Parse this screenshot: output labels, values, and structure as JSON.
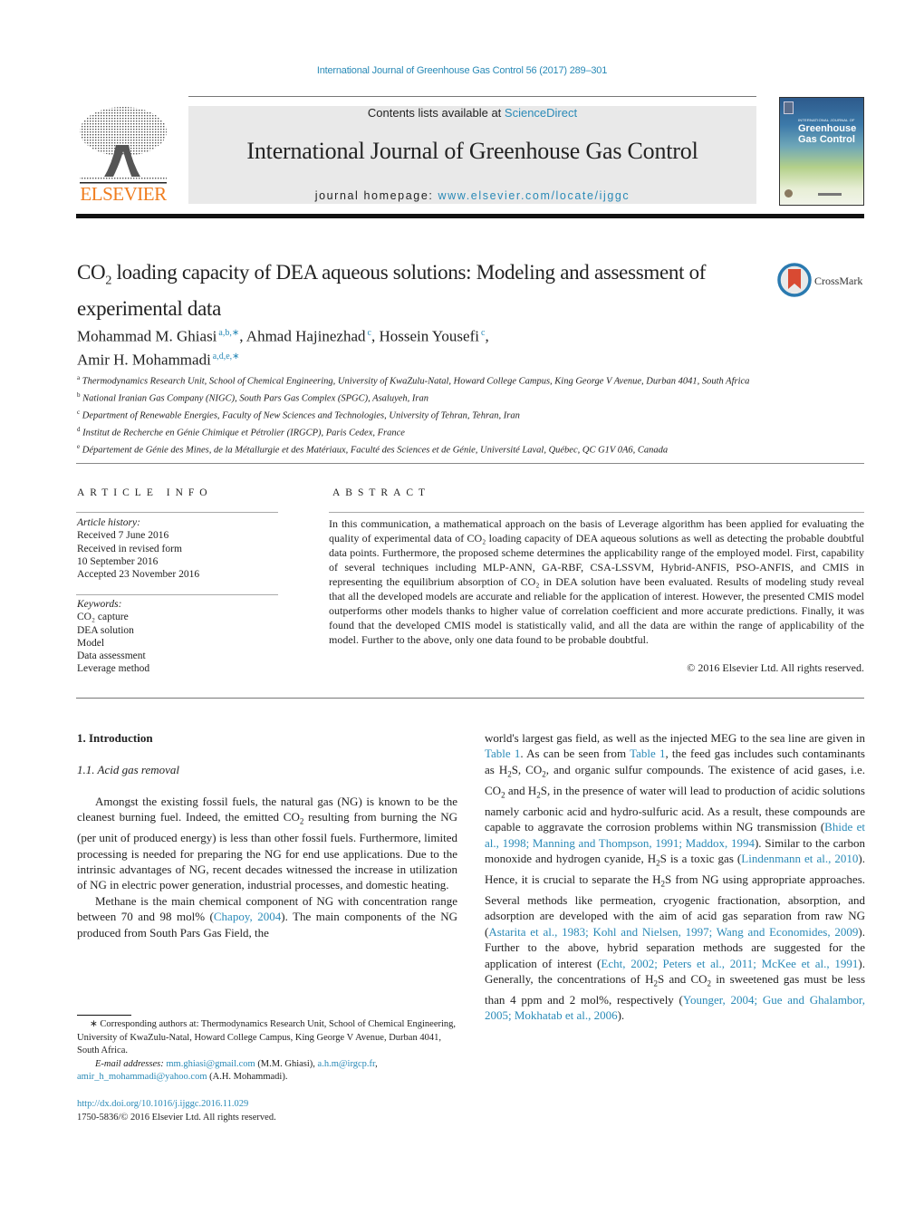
{
  "header": {
    "citation": "International Journal of Greenhouse Gas Control 56 (2017) 289–301",
    "publisher_logo_text": "ELSEVIER",
    "contents_prefix": "Contents lists available at ",
    "contents_link": "ScienceDirect",
    "journal_title": "International Journal of Greenhouse Gas Control",
    "homepage_prefix": "journal homepage: ",
    "homepage_link": "www.elsevier.com/locate/ijggc",
    "cover": {
      "small_text": "INTERNATIONAL JOURNAL OF",
      "title_line1": "Greenhouse",
      "title_line2": "Gas Control"
    }
  },
  "article": {
    "title_pre": "CO",
    "title_sub": "2",
    "title_post": " loading capacity of DEA aqueous solutions: Modeling and assessment of experimental data",
    "crossmark_label": "CrossMark",
    "authors": [
      {
        "name": "Mohammad M. Ghiasi",
        "sup": "a,b,∗",
        "sep": ", "
      },
      {
        "name": "Ahmad Hajinezhad",
        "sup": "c",
        "sep": ", "
      },
      {
        "name": "Hossein Yousefi",
        "sup": "c",
        "sep": ","
      },
      {
        "name": "Amir H. Mohammadi",
        "sup": "a,d,e,∗",
        "sep": ""
      }
    ],
    "affiliations": [
      {
        "key": "a",
        "text": "Thermodynamics Research Unit, School of Chemical Engineering, University of KwaZulu-Natal, Howard College Campus, King George V Avenue, Durban 4041, South Africa"
      },
      {
        "key": "b",
        "text": "National Iranian Gas Company (NIGC), South Pars Gas Complex (SPGC), Asaluyeh, Iran"
      },
      {
        "key": "c",
        "text": "Department of Renewable Energies, Faculty of New Sciences and Technologies, University of Tehran, Tehran, Iran"
      },
      {
        "key": "d",
        "text": "Institut de Recherche en Génie Chimique et Pétrolier (IRGCP), Paris Cedex, France"
      },
      {
        "key": "e",
        "text": "Département de Génie des Mines, de la Métallurgie et des Matériaux, Faculté des Sciences et de Génie, Université Laval, Québec, QC G1V 0A6, Canada"
      }
    ]
  },
  "article_info": {
    "heading": "ARTICLE INFO",
    "history_label": "Article history:",
    "history": [
      "Received 7 June 2016",
      "Received in revised form",
      "10 September 2016",
      "Accepted 23 November 2016"
    ],
    "keywords_label": "Keywords:",
    "keywords": [
      "CO₂ capture",
      "DEA solution",
      "Model",
      "Data assessment",
      "Leverage method"
    ]
  },
  "abstract": {
    "heading": "ABSTRACT",
    "text": "In this communication, a mathematical approach on the basis of Leverage algorithm has been applied for evaluating the quality of experimental data of CO₂ loading capacity of DEA aqueous solutions as well as detecting the probable doubtful data points. Furthermore, the proposed scheme determines the applicability range of the employed model. First, capability of several techniques including MLP-ANN, GA-RBF, CSA-LSSVM, Hybrid-ANFIS, PSO-ANFIS, and CMIS in representing the equilibrium absorption of CO₂ in DEA solution have been evaluated. Results of modeling study reveal that all the developed models are accurate and reliable for the application of interest. However, the presented CMIS model outperforms other models thanks to higher value of correlation coefficient and more accurate predictions. Finally, it was found that the developed CMIS model is statistically valid, and all the data are within the range of applicability of the model. Further to the above, only one data found to be probable doubtful.",
    "copyright": "© 2016 Elsevier Ltd. All rights reserved."
  },
  "body": {
    "section1_heading": "1.  Introduction",
    "subsection11_heading": "1.1.  Acid gas removal",
    "para1": [
      {
        "t": "Amongst the existing fossil fuels, the natural gas (NG) is known to be the cleanest burning fuel. Indeed, the emitted CO"
      },
      {
        "sub": "2"
      },
      {
        "t": " resulting from burning the NG (per unit of produced energy) is less than other fossil fuels. Furthermore, limited processing is needed for preparing the NG for end use applications. Due to the intrinsic advantages of NG, recent decades witnessed the increase in utilization of NG in electric power generation, industrial processes, and domestic heating."
      }
    ],
    "para2": [
      {
        "t": "Methane is the main chemical component of NG with concentration range between 70 and 98 mol% ("
      },
      {
        "link": "Chapoy, 2004"
      },
      {
        "t": "). The main components of the NG produced from South Pars Gas Field, the world's largest gas field, as well as the injected MEG to the sea line are given in "
      },
      {
        "link": "Table 1"
      },
      {
        "t": ". As can be seen from "
      },
      {
        "link": "Table 1"
      },
      {
        "t": ", the feed gas includes such contaminants as H"
      },
      {
        "sub": "2"
      },
      {
        "t": "S, CO"
      },
      {
        "sub": "2"
      },
      {
        "t": ", and organic sulfur compounds. The existence of acid gases, i.e. CO"
      },
      {
        "sub": "2"
      },
      {
        "t": " and H"
      },
      {
        "sub": "2"
      },
      {
        "t": "S, in the presence of water will lead to production of acidic solutions namely carbonic acid and hydro-sulfuric acid. As a result, these compounds are capable to aggravate the corrosion problems within NG transmission ("
      },
      {
        "link": "Bhide et al., 1998; Manning and Thompson, 1991; Maddox, 1994"
      },
      {
        "t": "). Similar to the carbon monoxide and hydrogen cyanide, H"
      },
      {
        "sub": "2"
      },
      {
        "t": "S is a toxic gas ("
      },
      {
        "link": "Lindenmann et al., 2010"
      },
      {
        "t": "). Hence, it is crucial to separate the H"
      },
      {
        "sub": "2"
      },
      {
        "t": "S from NG using appropriate approaches. Several methods like permeation, cryogenic fractionation, absorption, and adsorption are developed with the aim of acid gas separation from raw NG ("
      },
      {
        "link": "Astarita et al., 1983; Kohl and Nielsen, 1997; Wang and Economides, 2009"
      },
      {
        "t": "). Further to the above, hybrid separation methods are suggested for the application of interest ("
      },
      {
        "link": "Echt, 2002; Peters et al., 2011; McKee et al., 1991"
      },
      {
        "t": "). Generally, the concentrations of H"
      },
      {
        "sub": "2"
      },
      {
        "t": "S and CO"
      },
      {
        "sub": "2"
      },
      {
        "t": " in sweetened gas must be less than 4 ppm and 2 mol%, respectively ("
      },
      {
        "link": "Younger, 2004; Gue and Ghalambor, 2005; Mokhatab et al., 2006"
      },
      {
        "t": ")."
      }
    ]
  },
  "footnotes": {
    "corresponding": "∗  Corresponding authors at: Thermodynamics Research Unit, School of Chemical Engineering, University of KwaZulu-Natal, Howard College Campus, King George V Avenue, Durban 4041, South Africa.",
    "email_label": "E-mail addresses:",
    "emails": [
      {
        "addr": "mm.ghiasi@gmail.com",
        "who": " (M.M. Ghiasi), "
      },
      {
        "addr": "a.h.m@irgcp.fr",
        "who": ", "
      },
      {
        "addr": "amir_h_mohammadi@yahoo.com",
        "who": " (A.H. Mohammadi)."
      }
    ],
    "doi": "http://dx.doi.org/10.1016/j.ijggc.2016.11.029",
    "issn": "1750-5836/© 2016 Elsevier Ltd. All rights reserved."
  }
}
